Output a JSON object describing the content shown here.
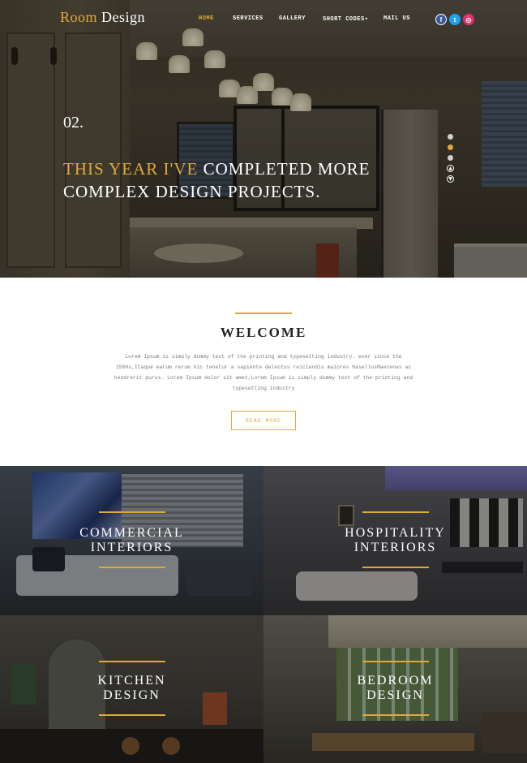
{
  "brand": {
    "logo_first": "Room",
    "logo_second": "Design",
    "accent_color": "#e2a83a"
  },
  "nav": {
    "items": [
      {
        "label": "HOME",
        "active": true
      },
      {
        "label": "SERVICES",
        "active": false
      },
      {
        "label": "GALLERY",
        "active": false
      },
      {
        "label": "SHORT CODES",
        "active": false,
        "caret": "▾"
      },
      {
        "label": "MAIL US",
        "active": false
      }
    ],
    "social": [
      {
        "icon": "facebook-icon",
        "glyph": "f",
        "color": "#3b5998"
      },
      {
        "icon": "twitter-icon",
        "glyph": "t",
        "color": "#1da1f2"
      },
      {
        "icon": "instagram-icon",
        "glyph": "◎",
        "color": "#e1306c"
      }
    ]
  },
  "hero": {
    "slide_number": "02.",
    "headline_highlight": "THIS YEAR I'VE",
    "headline_rest": " COMPLETED MORE COMPLEX DESIGN PROJECTS.",
    "pager": {
      "total": 3,
      "active": 2
    },
    "arrow_up": "▲",
    "arrow_down": "▼"
  },
  "welcome": {
    "title": "WELCOME",
    "body": "Lorem Ipsum is simply dummy text of the printing and typesetting industry. ever since the 1500s,Itaque earum rerum hic tenetur a sapiente delectus reiciendis maiores HasellusMaecenas ac hendrerit purus. Lorem Ipsum dolor sit amet,Lorem Ipsum is simply dummy text of the printing and typesetting industry",
    "button": "READ MORE"
  },
  "services": [
    {
      "line1": "Commercial",
      "line2": "Interiors"
    },
    {
      "line1": "Hospitality",
      "line2": "Interiors"
    },
    {
      "line1": "Kitchen",
      "line2": "Design"
    },
    {
      "line1": "Bedroom",
      "line2": "Design"
    }
  ]
}
